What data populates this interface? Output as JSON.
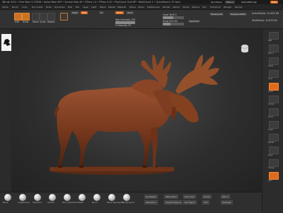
{
  "window": {
    "title": "ZBrush 2021 • Free Mem 3.729GB • Active Mem 897 • Scratch Disk 49 • ZTime 1.4 • RTime 0.25 • PolyCount 10.6 MP • MeshCount 1 • QuickSave In 23 Secs",
    "quicksave": "QuickSave",
    "menus": "Menus",
    "default_zscript": "DefaultZScript",
    "help": "Help"
  },
  "menu": [
    "Alpha",
    "Brush",
    "Color",
    "Document",
    "Draw",
    "Dynamics",
    "Edit",
    "File",
    "Layer",
    "Light",
    "Macro",
    "Marker",
    "Material",
    "Movie",
    "Picker",
    "Preferences",
    "Render",
    "Stencil",
    "Stroke",
    "Texture",
    "Tool",
    "Transform",
    "Zplugin",
    "Zscript"
  ],
  "top_shelf": {
    "edit": "Edit",
    "draw": "Draw",
    "move": "Move",
    "scale": "Scale",
    "rotate": "Rotate",
    "mrgb": "Mrgb",
    "rgb": "Rgb",
    "m": "M",
    "zadd": "Zadd",
    "zsub": "Zsub",
    "focal_shift_label": "Focal Shift 0",
    "draw_size_label": "Draw Size 64",
    "z_intensity_label": "Z Intensity 25",
    "rgb_intensity_label": "Rgb Intensity 100",
    "dynamic": "Dynamic",
    "active_points": "ActivePoints: 10.633 Mil",
    "total_points": "TotalPoints: 10.633 Mil",
    "replay_last": "ReplayLast",
    "replay_last_rel": "ReplayLastRel",
    "draw_size_value": 0.35,
    "focal_value": 0.5,
    "z_intensity_value": 0.25,
    "rgb_intensity_value": 1.0
  },
  "bottom_shelf": {
    "brushes": [
      "Move",
      "ClayBuildup",
      "Standard",
      "hPolish",
      "Dam_Standard",
      "Inflate",
      "Pinch",
      "Move Topological",
      "TrimDynamic"
    ],
    "dynamesh": "DynaMesh",
    "resolution": "Resolution",
    "zremesher": "ZRemesher",
    "target_polygons": "Target Polygons",
    "del_lower": "Del Lower",
    "del_higher": "Del Higher",
    "divide": "Divide",
    "smt": "Smt",
    "sdiv": "SDiv 5",
    "spotlight": "Spotlight"
  },
  "right_shelf": {
    "labels": [
      "BPR",
      "SPix 3",
      "Persp",
      "Floor",
      "Local",
      "Frame",
      "Move",
      "Scale",
      "Rotate",
      "PolyF",
      "Transp",
      "Solo"
    ]
  },
  "colors": {
    "accent": "#e06a1b",
    "bronze": "#7a3a1e"
  }
}
